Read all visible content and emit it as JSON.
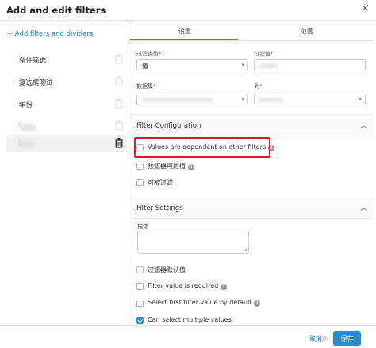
{
  "dialog": {
    "title": "Add and edit filters",
    "close_glyph": "×"
  },
  "sidebar": {
    "add_link": "+ Add filters and dividers",
    "filters": [
      {
        "name": "条件筛选"
      },
      {
        "name": "复选框测试"
      },
      {
        "name": "年份"
      },
      {
        "name": ""
      },
      {
        "name": ""
      }
    ]
  },
  "tabs": [
    {
      "label": "设置",
      "active": true
    },
    {
      "label": "范围",
      "active": false
    }
  ],
  "fields": {
    "filter_type_label": "过滤类型",
    "filter_type_value": "值",
    "filter_name_label": "过滤值",
    "dataset_label": "数据集",
    "column_label": "列",
    "required_mark": "*"
  },
  "filter_configuration": {
    "title": "Filter Configuration",
    "options": [
      {
        "label": "Values are dependent on other filters",
        "checked": false,
        "info": true
      },
      {
        "label": "预滤器可用值",
        "checked": false,
        "info": true
      },
      {
        "label": "可被过滤",
        "checked": false,
        "info": false
      }
    ]
  },
  "filter_settings": {
    "title": "Filter Settings",
    "description_label": "描述",
    "options": [
      {
        "label": "过滤器默认值",
        "checked": false,
        "info": false
      },
      {
        "label": "Filter value is required",
        "checked": false,
        "info": true
      },
      {
        "label": "Select first filter value by default",
        "checked": false,
        "info": true
      },
      {
        "label": "Can select multiple values",
        "checked": true,
        "info": false
      }
    ]
  },
  "footer": {
    "cancel_label": "取消",
    "save_label": "保存",
    "watermark": "CSDN @allinpp"
  },
  "colors": {
    "accent": "#1f8fd0",
    "highlight_border": "#e0162b",
    "required": "#e04355"
  }
}
